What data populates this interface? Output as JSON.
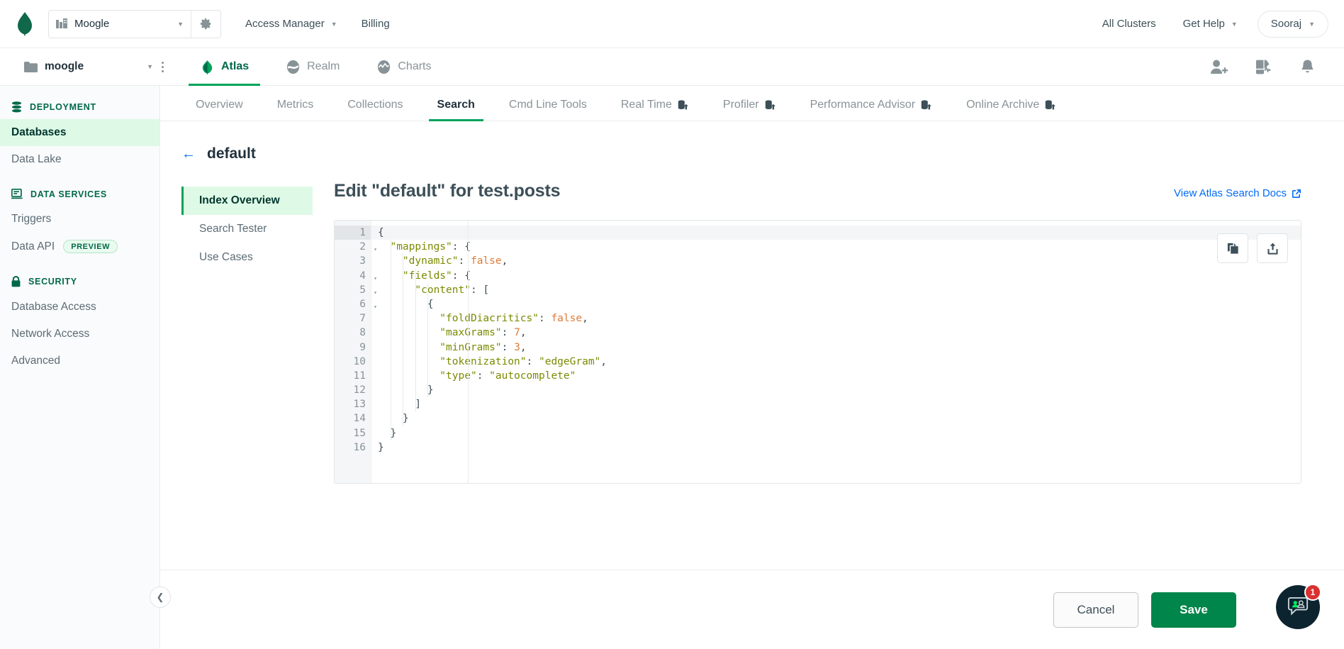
{
  "orgbar": {
    "logo_icon": "mongodb-leaf-icon",
    "org_icon": "building-icon",
    "org_name": "Moogle",
    "org_caret_icon": "chevron-down-icon",
    "org_settings_icon": "gear-icon",
    "access_manager": "Access Manager",
    "access_manager_caret_icon": "chevron-down-icon",
    "billing": "Billing",
    "all_clusters": "All Clusters",
    "get_help": "Get Help",
    "get_help_caret_icon": "chevron-down-icon",
    "user_name": "Sooraj",
    "user_caret_icon": "chevron-down-icon"
  },
  "projbar": {
    "project_icon": "folder-icon",
    "project_name": "moogle",
    "project_caret_icon": "chevron-down-icon",
    "kebab_icon": "ellipsis-vertical-icon",
    "products": [
      {
        "label": "Atlas",
        "icon": "atlas-leaf-icon",
        "active": true
      },
      {
        "label": "Realm",
        "icon": "realm-icon",
        "active": false
      },
      {
        "label": "Charts",
        "icon": "charts-icon",
        "active": false
      }
    ],
    "right_icons": [
      {
        "name": "invite-user-icon"
      },
      {
        "name": "activity-feed-icon"
      },
      {
        "name": "bell-notification-icon"
      }
    ]
  },
  "sidebar": {
    "groups": [
      {
        "label": "DEPLOYMENT",
        "icon": "database-icon",
        "items": [
          {
            "label": "Databases",
            "active": true
          },
          {
            "label": "Data Lake",
            "active": false
          }
        ]
      },
      {
        "label": "DATA SERVICES",
        "icon": "app-services-icon",
        "items": [
          {
            "label": "Triggers",
            "active": false
          },
          {
            "label": "Data API",
            "active": false,
            "badge": "PREVIEW"
          }
        ]
      },
      {
        "label": "SECURITY",
        "icon": "lock-icon",
        "items": [
          {
            "label": "Database Access",
            "active": false
          },
          {
            "label": "Network Access",
            "active": false
          },
          {
            "label": "Advanced",
            "active": false
          }
        ]
      }
    ],
    "collapse_icon": "chevron-left-icon"
  },
  "tabs": [
    {
      "label": "Overview",
      "active": false,
      "locked": false
    },
    {
      "label": "Metrics",
      "active": false,
      "locked": false
    },
    {
      "label": "Collections",
      "active": false,
      "locked": false
    },
    {
      "label": "Search",
      "active": true,
      "locked": false
    },
    {
      "label": "Cmd Line Tools",
      "active": false,
      "locked": false
    },
    {
      "label": "Real Time",
      "active": false,
      "locked": true
    },
    {
      "label": "Profiler",
      "active": false,
      "locked": true
    },
    {
      "label": "Performance Advisor",
      "active": false,
      "locked": true
    },
    {
      "label": "Online Archive",
      "active": false,
      "locked": true
    }
  ],
  "page": {
    "back_icon": "arrow-left-icon",
    "back_label": "default",
    "subnav": [
      {
        "label": "Index Overview",
        "active": true
      },
      {
        "label": "Search Tester",
        "active": false
      },
      {
        "label": "Use Cases",
        "active": false
      }
    ],
    "title": "Edit \"default\" for test.posts",
    "docs_link": "View Atlas Search Docs",
    "docs_link_icon": "external-link-icon",
    "editor": {
      "copy_icon": "copy-icon",
      "export_icon": "export-icon",
      "current_line": 1,
      "lines": [
        {
          "n": 1,
          "fold": true,
          "tokens": [
            {
              "t": "{",
              "c": "pun"
            }
          ]
        },
        {
          "n": 2,
          "fold": true,
          "tokens": [
            {
              "t": "  \"mappings\"",
              "c": "k"
            },
            {
              "t": ": {",
              "c": "pun"
            }
          ]
        },
        {
          "n": 3,
          "fold": false,
          "tokens": [
            {
              "t": "    \"dynamic\"",
              "c": "k"
            },
            {
              "t": ": ",
              "c": "pun"
            },
            {
              "t": "false",
              "c": "bool"
            },
            {
              "t": ",",
              "c": "pun"
            }
          ]
        },
        {
          "n": 4,
          "fold": true,
          "tokens": [
            {
              "t": "    \"fields\"",
              "c": "k"
            },
            {
              "t": ": {",
              "c": "pun"
            }
          ]
        },
        {
          "n": 5,
          "fold": true,
          "tokens": [
            {
              "t": "      \"content\"",
              "c": "k"
            },
            {
              "t": ": [",
              "c": "pun"
            }
          ]
        },
        {
          "n": 6,
          "fold": true,
          "tokens": [
            {
              "t": "        {",
              "c": "pun"
            }
          ]
        },
        {
          "n": 7,
          "fold": false,
          "tokens": [
            {
              "t": "          \"foldDiacritics\"",
              "c": "k"
            },
            {
              "t": ": ",
              "c": "pun"
            },
            {
              "t": "false",
              "c": "bool"
            },
            {
              "t": ",",
              "c": "pun"
            }
          ]
        },
        {
          "n": 8,
          "fold": false,
          "tokens": [
            {
              "t": "          \"maxGrams\"",
              "c": "k"
            },
            {
              "t": ": ",
              "c": "pun"
            },
            {
              "t": "7",
              "c": "num"
            },
            {
              "t": ",",
              "c": "pun"
            }
          ]
        },
        {
          "n": 9,
          "fold": false,
          "tokens": [
            {
              "t": "          \"minGrams\"",
              "c": "k"
            },
            {
              "t": ": ",
              "c": "pun"
            },
            {
              "t": "3",
              "c": "num"
            },
            {
              "t": ",",
              "c": "pun"
            }
          ]
        },
        {
          "n": 10,
          "fold": false,
          "tokens": [
            {
              "t": "          \"tokenization\"",
              "c": "k"
            },
            {
              "t": ": ",
              "c": "pun"
            },
            {
              "t": "\"edgeGram\"",
              "c": "str"
            },
            {
              "t": ",",
              "c": "pun"
            }
          ]
        },
        {
          "n": 11,
          "fold": false,
          "tokens": [
            {
              "t": "          \"type\"",
              "c": "k"
            },
            {
              "t": ": ",
              "c": "pun"
            },
            {
              "t": "\"autocomplete\"",
              "c": "str"
            }
          ]
        },
        {
          "n": 12,
          "fold": false,
          "tokens": [
            {
              "t": "        }",
              "c": "pun"
            }
          ]
        },
        {
          "n": 13,
          "fold": false,
          "tokens": [
            {
              "t": "      ]",
              "c": "pun"
            }
          ]
        },
        {
          "n": 14,
          "fold": false,
          "tokens": [
            {
              "t": "    }",
              "c": "pun"
            }
          ]
        },
        {
          "n": 15,
          "fold": false,
          "tokens": [
            {
              "t": "  }",
              "c": "pun"
            }
          ]
        },
        {
          "n": 16,
          "fold": false,
          "tokens": [
            {
              "t": "}",
              "c": "pun"
            }
          ]
        }
      ]
    }
  },
  "footer": {
    "cancel_label": "Cancel",
    "save_label": "Save"
  },
  "chat": {
    "icon": "chat-support-icon",
    "badge_count": "1"
  },
  "colors": {
    "brand_green": "#00684a",
    "accent_green": "#00a35c",
    "save_green": "#00854a",
    "link_blue": "#016bf8",
    "badge_red": "#db3030",
    "sidebar_active": "#defae6"
  }
}
